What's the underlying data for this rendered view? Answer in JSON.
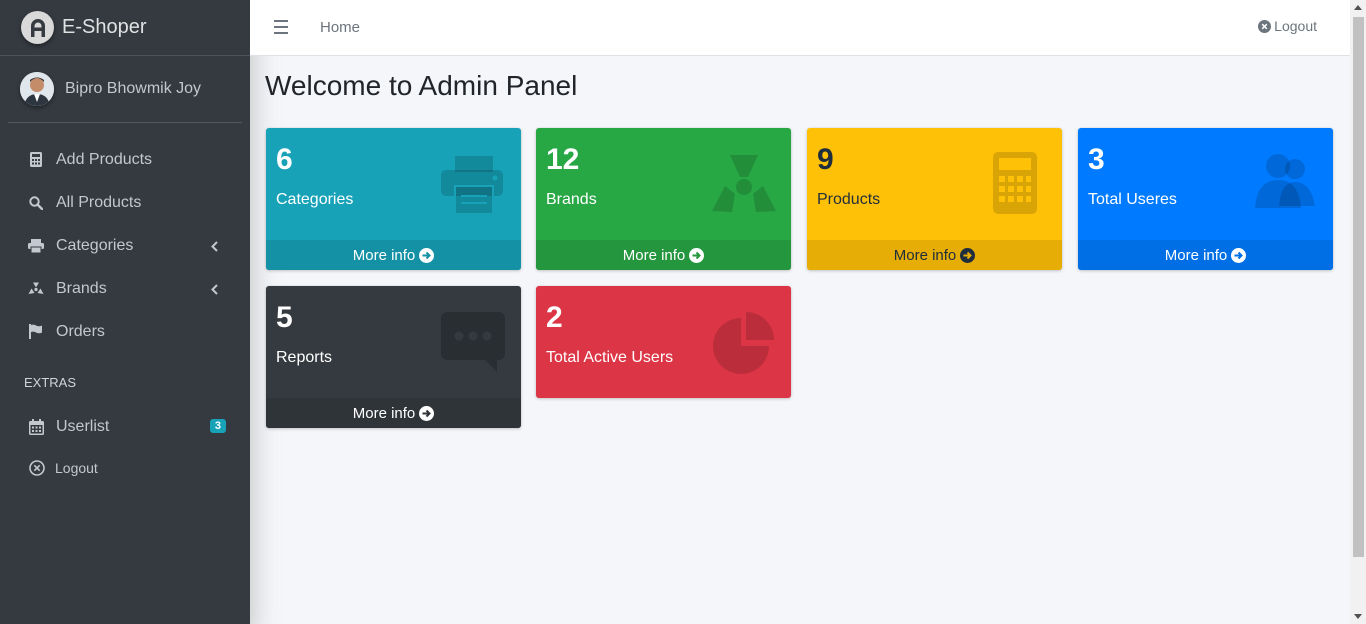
{
  "brand": {
    "name": "E-Shoper"
  },
  "user": {
    "name": "Bipro Bhowmik Joy"
  },
  "sidebar": {
    "items": [
      {
        "label": "Add Products",
        "icon": "calculator-icon"
      },
      {
        "label": "All Products",
        "icon": "search-icon"
      },
      {
        "label": "Categories",
        "icon": "print-icon"
      },
      {
        "label": "Brands",
        "icon": "radiation-icon"
      },
      {
        "label": "Orders",
        "icon": "flag-icon"
      }
    ],
    "extras_header": "EXTRAS",
    "userlist": {
      "label": "Userlist",
      "badge": "3"
    },
    "logout": "Logout"
  },
  "topbar": {
    "home": "Home",
    "logout": "Logout"
  },
  "main": {
    "title": "Welcome to Admin Panel",
    "boxes": [
      {
        "count": "6",
        "label": "Categories",
        "footer": "More info",
        "color": "#17a2b8"
      },
      {
        "count": "12",
        "label": "Brands",
        "footer": "More info",
        "color": "#28a745"
      },
      {
        "count": "9",
        "label": "Products",
        "footer": "More info",
        "color": "#ffc107"
      },
      {
        "count": "3",
        "label": "Total Useres",
        "footer": "More info",
        "color": "#007bff"
      },
      {
        "count": "5",
        "label": "Reports",
        "footer": "More info",
        "color": "#343a40"
      },
      {
        "count": "2",
        "label": "Total Active Users",
        "color": "#dc3545"
      }
    ]
  }
}
